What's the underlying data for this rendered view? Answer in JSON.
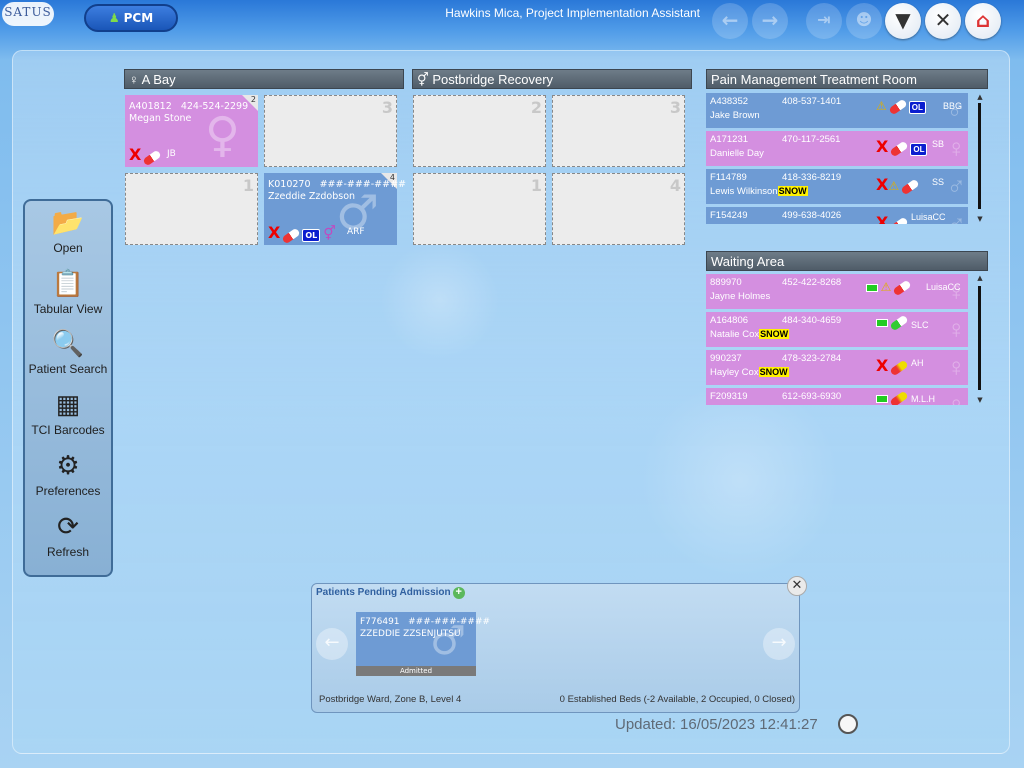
{
  "app": {
    "logo": "SATUS",
    "module_label": "PCM",
    "user": "Hawkins Mica, Project Implementation Assistant"
  },
  "toolbar": [
    {
      "name": "back-button",
      "icon": "arrow-left-icon",
      "enabled": false
    },
    {
      "name": "forward-button",
      "icon": "arrow-right-icon",
      "enabled": false
    },
    {
      "name": "logout-button",
      "icon": "exit-icon",
      "enabled": false
    },
    {
      "name": "users-button",
      "icon": "users-icon",
      "enabled": false
    },
    {
      "name": "filter-button",
      "icon": "filter-icon",
      "enabled": true
    },
    {
      "name": "close-button",
      "icon": "close-icon",
      "enabled": true
    },
    {
      "name": "home-button",
      "icon": "home-icon",
      "enabled": true
    }
  ],
  "sidenav": [
    {
      "label": "Open",
      "icon": "folder-icon"
    },
    {
      "label": "Tabular View",
      "icon": "clipboard-icon"
    },
    {
      "label": "Patient Search",
      "icon": "search-icon"
    },
    {
      "label": "TCI Barcodes",
      "icon": "qrcode-icon"
    },
    {
      "label": "Preferences",
      "icon": "gear-icon"
    },
    {
      "label": "Refresh",
      "icon": "refresh-icon"
    }
  ],
  "wards": {
    "a_bay": {
      "title": "A Bay",
      "beds": {
        "b2": {
          "num": "2",
          "id": "A401812",
          "phone": "424-524-2299",
          "name": "Megan Stone",
          "staff": "JB"
        },
        "b3": {
          "num": "3"
        },
        "b1": {
          "num": "1"
        },
        "b4": {
          "num": "4",
          "id": "K010270",
          "phone": "###-###-####",
          "name": "Zzeddie Zzdobson",
          "staff": "ARF",
          "flag": "OL"
        }
      }
    },
    "postbridge": {
      "title": "Postbridge Recovery",
      "beds": {
        "b2": {
          "num": "2"
        },
        "b3": {
          "num": "3"
        },
        "b1": {
          "num": "1"
        },
        "b4": {
          "num": "4"
        }
      }
    }
  },
  "pain_room": {
    "title": "Pain Management Treatment Room",
    "rows": [
      {
        "id": "A438352",
        "phone": "408-537-1401",
        "name": "Jake Brown",
        "staff": "BBG",
        "flag": "OL",
        "snow": ""
      },
      {
        "id": "A171231",
        "phone": "470-117-2561",
        "name": "Danielle Day",
        "staff": "SB",
        "flag": "OL",
        "snow": ""
      },
      {
        "id": "F114789",
        "phone": "418-336-8219",
        "name": "Lewis Wilkinson",
        "staff": "SS",
        "flag": "",
        "snow": "SNOW"
      },
      {
        "id": "F154249",
        "phone": "499-638-4026",
        "name": "",
        "staff": "LuisaCC",
        "flag": "",
        "snow": ""
      }
    ]
  },
  "waiting": {
    "title": "Waiting Area",
    "rows": [
      {
        "id": "889970",
        "phone": "452-422-8268",
        "name": "Jayne Holmes",
        "staff": "LuisaCC",
        "snow": ""
      },
      {
        "id": "A164806",
        "phone": "484-340-4659",
        "name": "Natalie Cox",
        "staff": "SLC",
        "snow": "SNOW"
      },
      {
        "id": "990237",
        "phone": "478-323-2784",
        "name": "Hayley Cox",
        "staff": "AH",
        "snow": "SNOW"
      },
      {
        "id": "F209319",
        "phone": "612-693-6930",
        "name": "",
        "staff": "M.L.H",
        "snow": ""
      }
    ]
  },
  "pending": {
    "title": "Patients Pending Admission",
    "card": {
      "id": "F776491",
      "phone": "###-###-####",
      "name": "ZZEDDIE ZZSENJUTSU",
      "status": "Admitted"
    },
    "location": "Postbridge Ward, Zone B, Level 4",
    "beds_summary": "0 Established Beds (-2 Available, 2 Occupied, 0 Closed)"
  },
  "updated": "Updated: 16/05/2023 12:41:27",
  "colors": {
    "female_card": "#d48fe0",
    "male_card": "#6e9bd4",
    "snow": "#fff200",
    "ol_badge": "#0a1ecf"
  }
}
